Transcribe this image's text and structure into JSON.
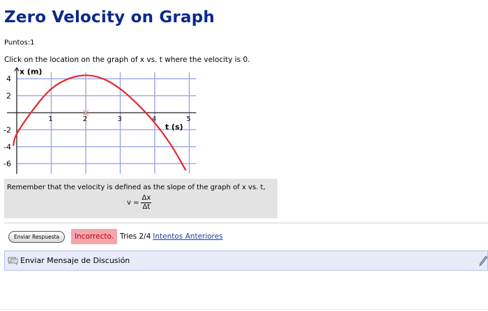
{
  "problem": {
    "title": "Zero Velocity on Graph",
    "points": "Puntos:1",
    "prompt": "Click on the location on the graph of x vs. t where the velocity is 0."
  },
  "graph": {
    "y_axis_label": "x (m)",
    "x_axis_label": "t (s)",
    "y_ticks": [
      "4",
      "2",
      "-2",
      "-4",
      "-6"
    ],
    "x_ticks": [
      "1",
      "2",
      "3",
      "4",
      "5"
    ],
    "curve_color": "#e8262a",
    "marker_color": "#f5a3a3",
    "curve": [
      {
        "t": -0.1,
        "x": -3.9
      },
      {
        "t": 0,
        "x": -2.5
      },
      {
        "t": 0.5,
        "x": 0.5
      },
      {
        "t": 1,
        "x": 2.8
      },
      {
        "t": 1.5,
        "x": 4.0
      },
      {
        "t": 2,
        "x": 4.4
      },
      {
        "t": 2.5,
        "x": 4.0
      },
      {
        "t": 3,
        "x": 2.8
      },
      {
        "t": 3.5,
        "x": 1.0
      },
      {
        "t": 4,
        "x": -1.2
      },
      {
        "t": 4.5,
        "x": -4.0
      },
      {
        "t": 4.9,
        "x": -6.8
      }
    ],
    "marked_point": {
      "t": 2,
      "x": 0
    }
  },
  "hint": {
    "text": "Remember that the velocity is defined as the slope of the graph of x vs. t,",
    "lhs": "v =",
    "numerator": "Δx",
    "denominator": "Δt"
  },
  "actions": {
    "submit_label": "Enviar Respuesta",
    "status_label": "Incorrecto.",
    "tries_text": "Tries 2/4",
    "previous_attempts_link": "Intentos Anteriores"
  },
  "discussion": {
    "label": "Enviar Mensaje de Discusión",
    "icon": "discussion-icon",
    "edit_icon": "pencil-icon"
  }
}
